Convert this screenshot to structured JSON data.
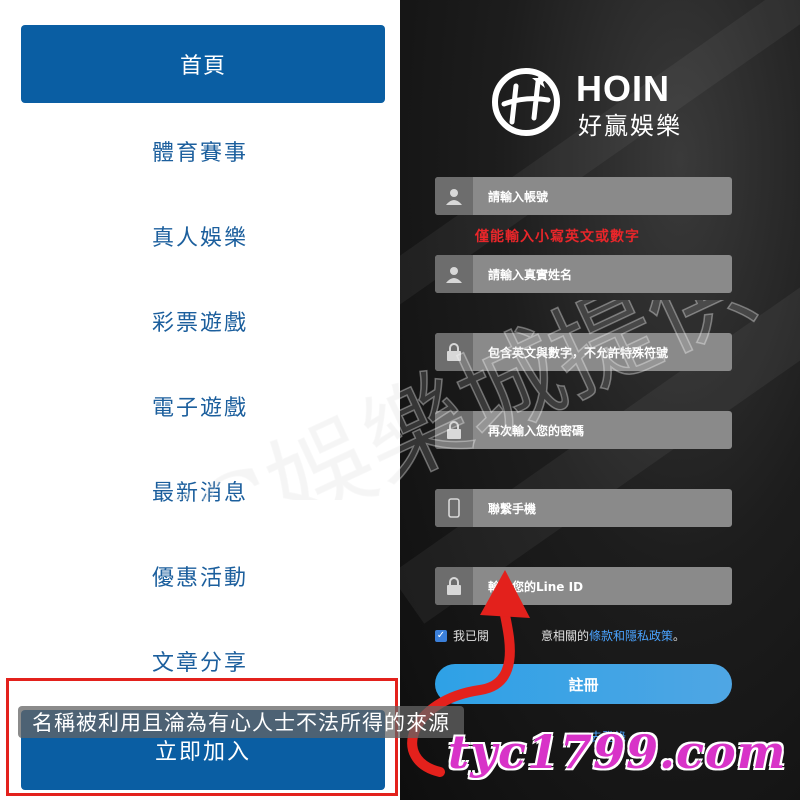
{
  "menu": {
    "home": "首頁",
    "items": [
      "體育賽事",
      "真人娛樂",
      "彩票遊戲",
      "電子遊戲",
      "最新消息",
      "優惠活動",
      "文章分享"
    ],
    "join": "立即加入"
  },
  "brand": {
    "name_en": "HOIN",
    "name_zh": "好贏娛樂"
  },
  "form": {
    "account_placeholder": "請輸入帳號",
    "account_hint": "僅能輸入小寫英文或數字",
    "realname_placeholder": "請輸入真實姓名",
    "password_placeholder": "包含英文與數字，不允許特殊符號",
    "confirm_placeholder": "再次輸入您的密碼",
    "phone_placeholder": "聯繫手機",
    "line_placeholder": "輸入您的Line ID",
    "agree_prefix": "我已閱",
    "agree_mid": "意相關的",
    "terms_link": "條款和隱私政策",
    "agree_suffix": "。",
    "agree_checked": true,
    "register_button": "註冊",
    "login_link": "去登錄"
  },
  "overlay": {
    "caption": "名稱被利用且淪為有心人士不法所得的來源",
    "site": "tyc1799.com",
    "watermark": "TYC娛樂城提供"
  },
  "colors": {
    "primary": "#0a5ea3",
    "menu_text": "#1c5f9d",
    "hint_red": "#e8262a",
    "register_blue": "#2ea1e6",
    "site_magenta": "#d833c8",
    "annotation_red": "#e3211c"
  }
}
